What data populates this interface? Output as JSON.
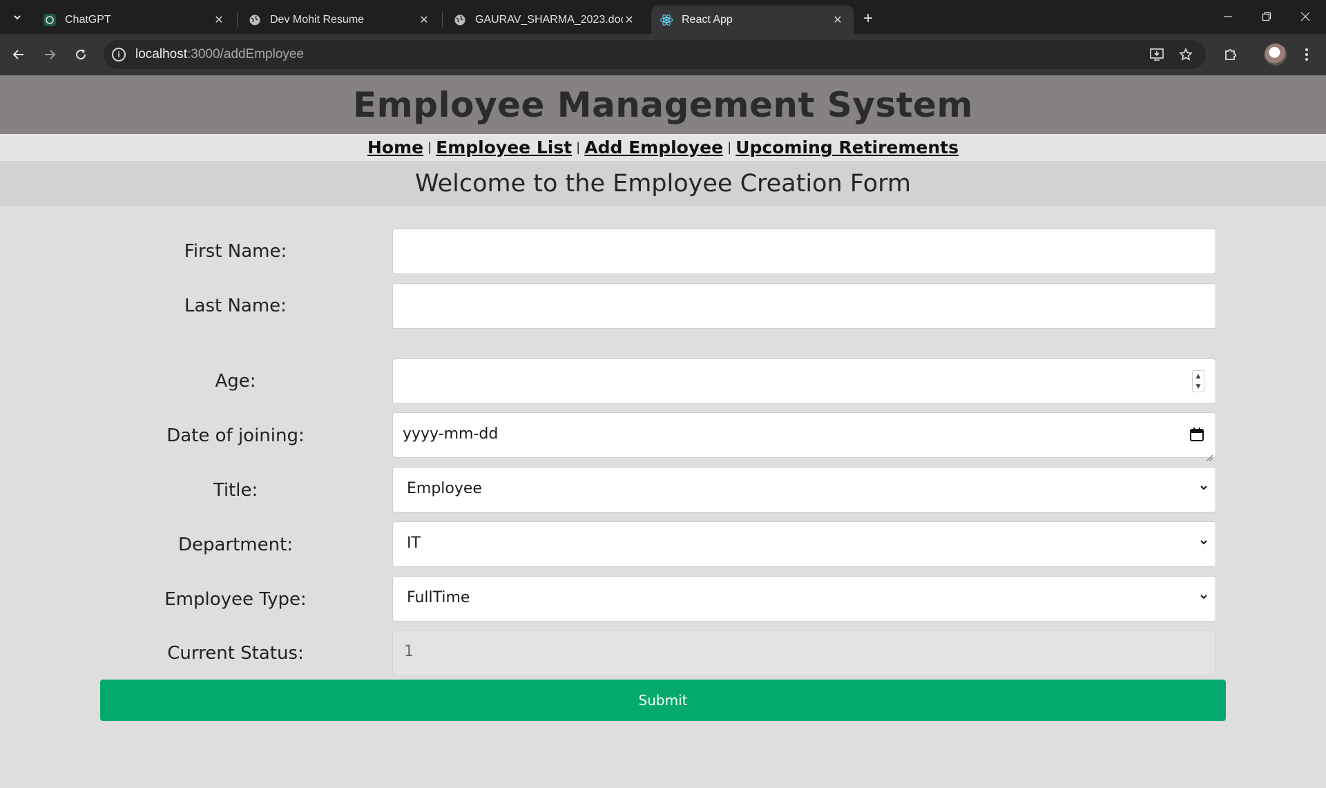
{
  "browser": {
    "tabs": [
      {
        "title": "ChatGPT",
        "favicon": "chatgpt-icon"
      },
      {
        "title": "Dev Mohit Resume",
        "favicon": "globe-icon"
      },
      {
        "title": "GAURAV_SHARMA_2023.docx",
        "favicon": "globe-icon"
      },
      {
        "title": "React App",
        "favicon": "react-icon",
        "active": true
      }
    ],
    "url_host": "localhost",
    "url_path": ":3000/addEmployee"
  },
  "app": {
    "title": "Employee Management System",
    "nav": {
      "home": "Home",
      "employee_list": "Employee List",
      "add_employee": "Add Employee",
      "upcoming_retirements": "Upcoming Retirements",
      "separator": "|"
    },
    "welcome": "Welcome to the Employee Creation Form"
  },
  "form": {
    "first_name": {
      "label": "First Name:",
      "value": ""
    },
    "last_name": {
      "label": "Last Name:",
      "value": ""
    },
    "age": {
      "label": "Age:",
      "value": ""
    },
    "date_of_joining": {
      "label": "Date of joining:",
      "placeholder": "yyyy-mm-dd"
    },
    "title": {
      "label": "Title:",
      "value": "Employee"
    },
    "department": {
      "label": "Department:",
      "value": "IT"
    },
    "employee_type": {
      "label": "Employee Type:",
      "value": "FullTime"
    },
    "current_status": {
      "label": "Current Status:",
      "value": "1"
    },
    "submit_label": "Submit"
  },
  "colors": {
    "header_bg": "#868282",
    "submit_bg": "#04aa6d",
    "page_bg": "#dedede"
  }
}
